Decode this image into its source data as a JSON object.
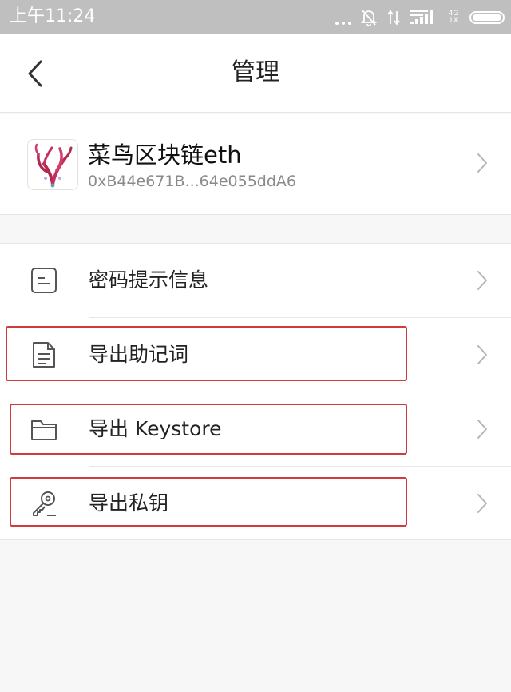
{
  "status_bar": {
    "time": "上午11:24",
    "network": [
      "4G",
      "1X"
    ]
  },
  "header": {
    "title": "管理",
    "back_icon": "chevron-left-icon"
  },
  "wallet": {
    "name": "菜鸟区块链eth",
    "address": "0xB44e671B...64e055ddA6",
    "avatar_icon": "coral-avatar-icon"
  },
  "menu": {
    "items": [
      {
        "label": "密码提示信息",
        "icon": "note-icon",
        "highlighted": false
      },
      {
        "label": "导出助记词",
        "icon": "document-icon",
        "highlighted": true
      },
      {
        "label": "导出 Keystore",
        "icon": "folder-icon",
        "highlighted": true
      },
      {
        "label": "导出私钥",
        "icon": "key-icon",
        "highlighted": true
      }
    ]
  },
  "colors": {
    "highlight_border": "#d23b3b",
    "status_bar_bg": "#bfbfbf",
    "page_bg": "#f7f7f7"
  }
}
